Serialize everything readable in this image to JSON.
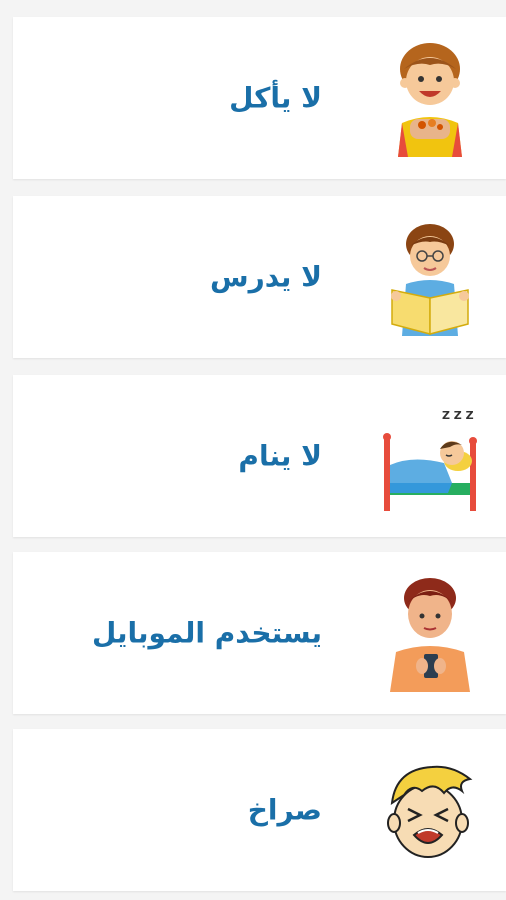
{
  "items": [
    {
      "label": "لا يأكل",
      "icon": "boy-eating-icon"
    },
    {
      "label": "لا يدرس",
      "icon": "boy-reading-icon"
    },
    {
      "label": "لا ينام",
      "icon": "boy-sleeping-icon"
    },
    {
      "label": "يستخدم الموبايل",
      "icon": "boy-using-phone-icon"
    },
    {
      "label": "صراخ",
      "icon": "boy-screaming-icon"
    }
  ],
  "colors": {
    "label_text": "#1a6fa8",
    "card_background": "#ffffff",
    "page_background": "#f4f4f4"
  }
}
